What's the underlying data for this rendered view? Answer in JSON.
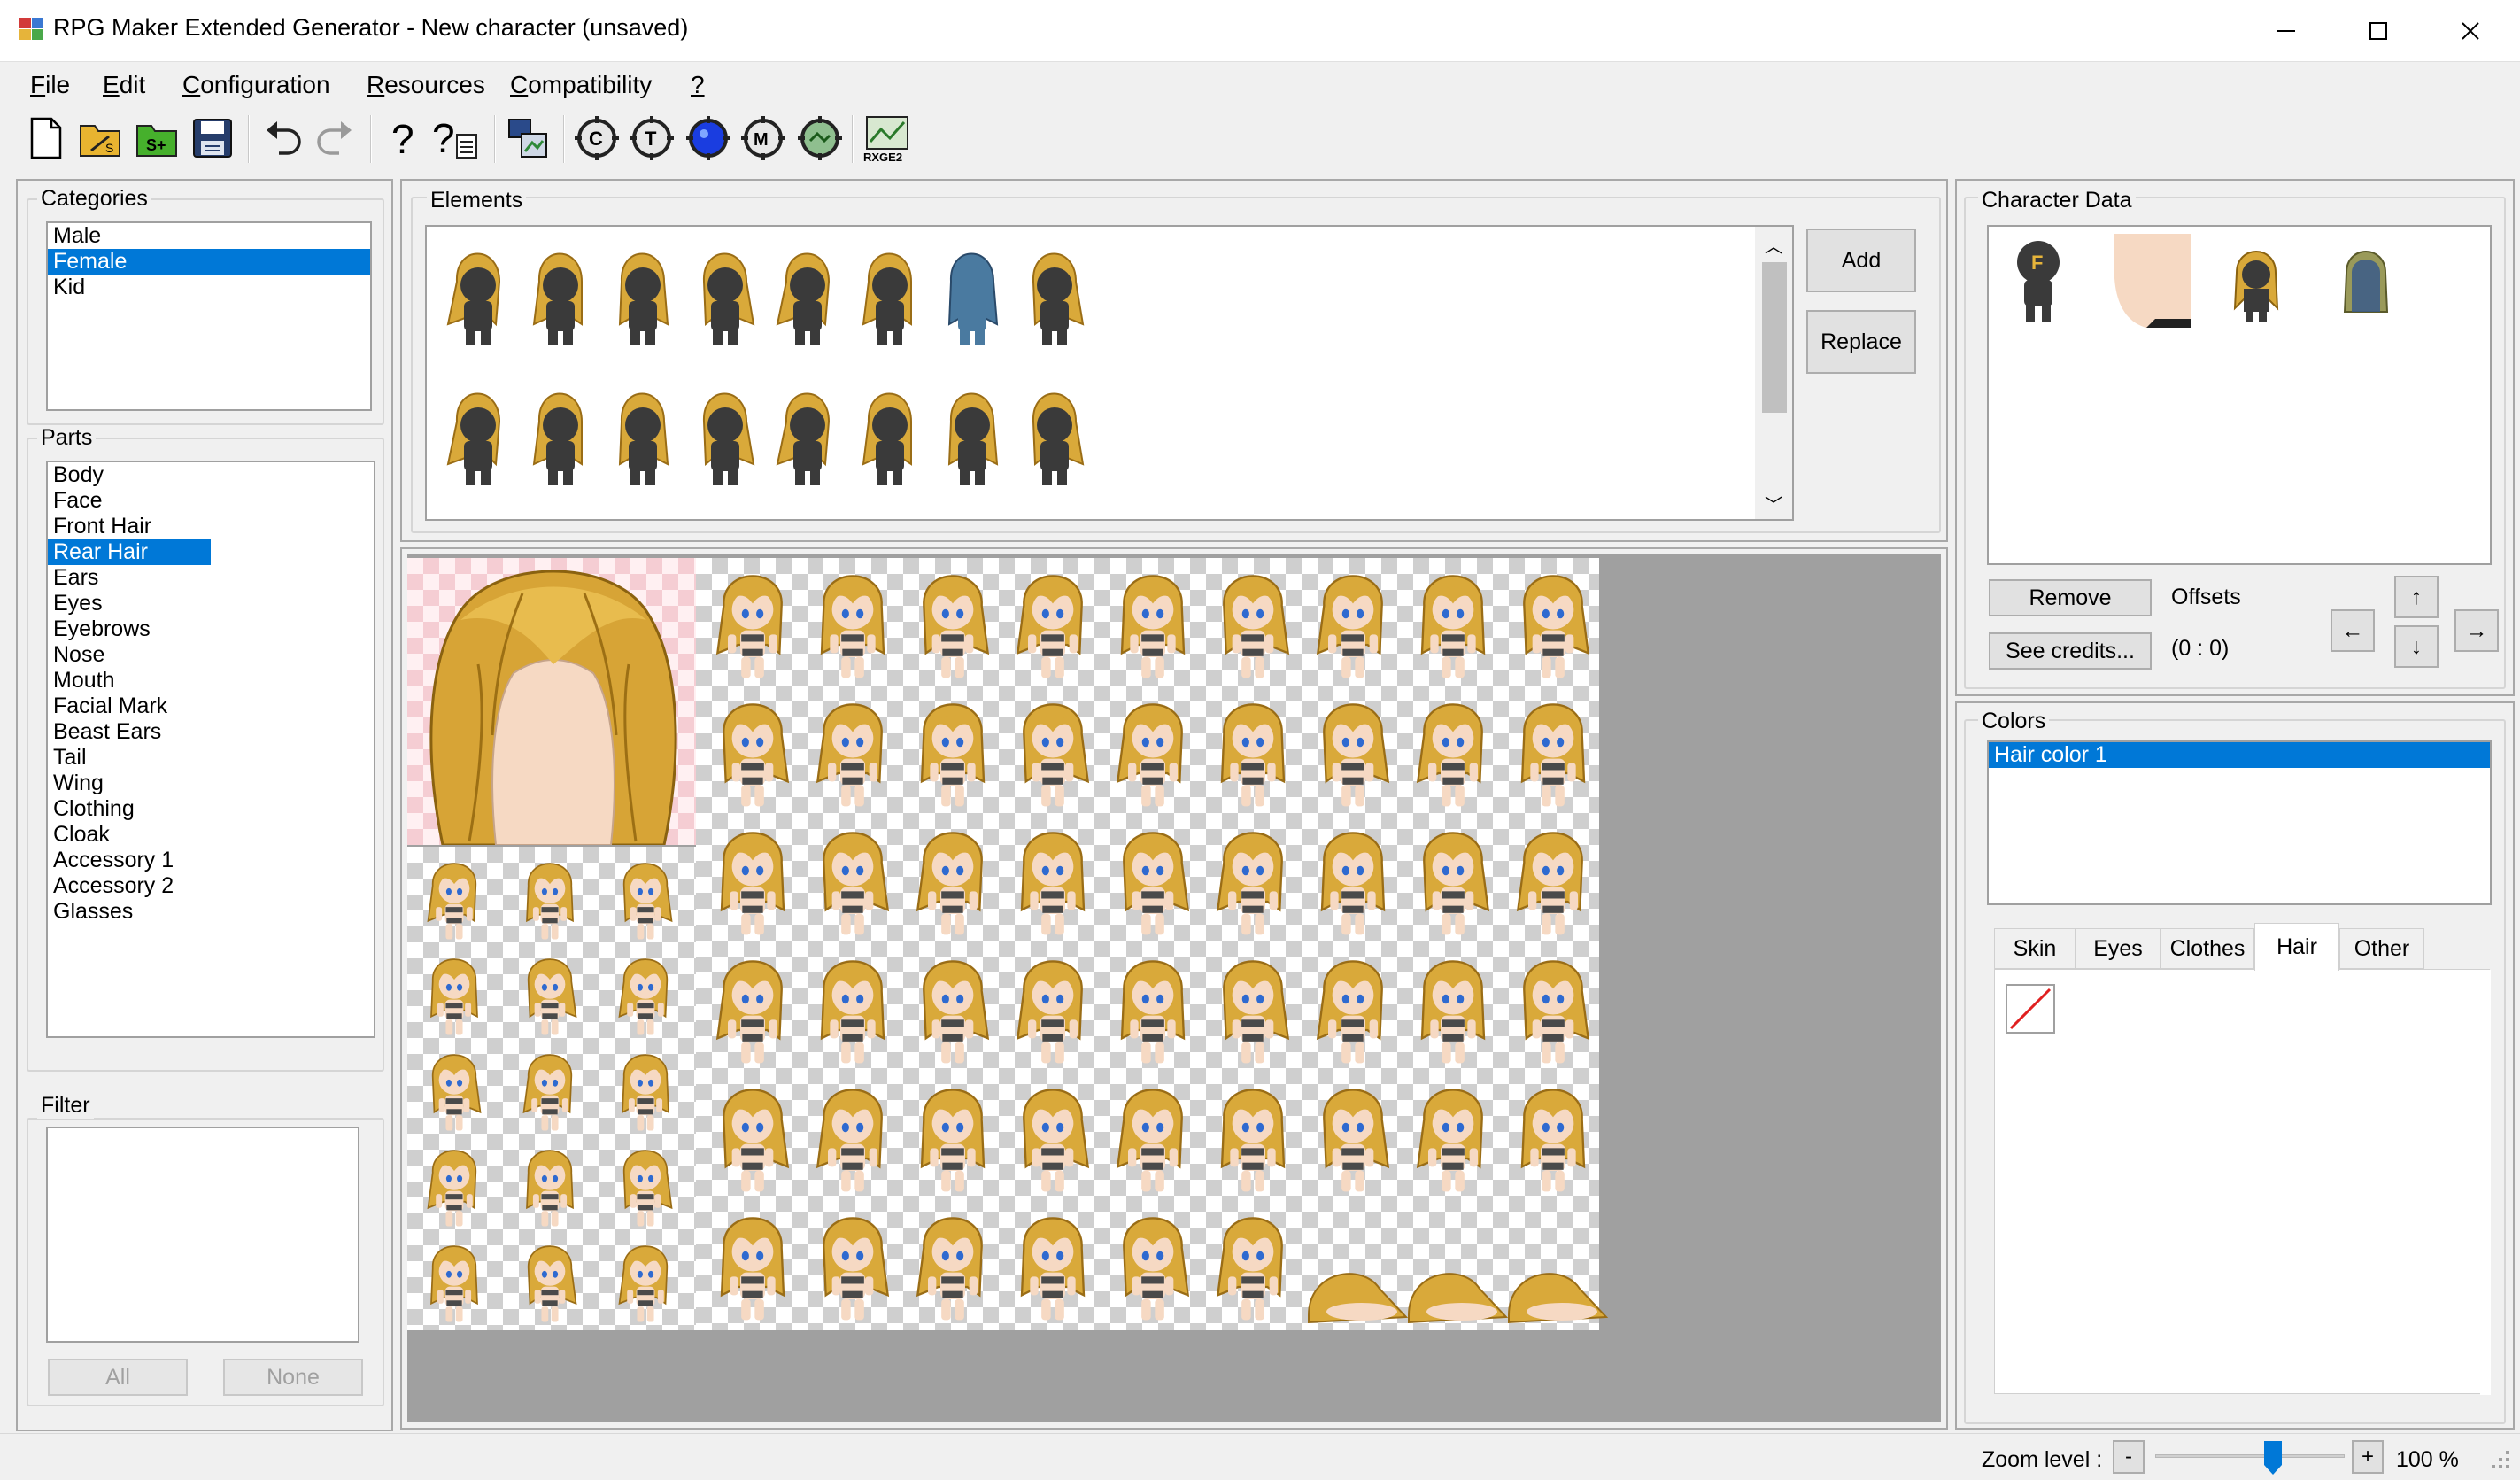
{
  "window": {
    "title": "RPG Maker Extended Generator - New character (unsaved)",
    "minimize_glyph": "—",
    "maximize_glyph": "☐",
    "close_glyph": "✕"
  },
  "menu": [
    {
      "label": "File",
      "accel": "F",
      "rest": "ile"
    },
    {
      "label": "Edit",
      "accel": "E",
      "rest": "dit"
    },
    {
      "label": "Configuration",
      "accel": "C",
      "rest": "onfiguration"
    },
    {
      "label": "Resources",
      "accel": "R",
      "rest": "esources"
    },
    {
      "label": "Compatibility",
      "accel": "C",
      "rest": "ompatibility"
    },
    {
      "label": "?",
      "accel": "?",
      "rest": ""
    }
  ],
  "toolbar": {
    "items": [
      "new-file-icon",
      "open-folder-icon",
      "add-folder-icon",
      "save-icon",
      "undo-icon",
      "redo-icon",
      "help-icon",
      "help-doc-icon",
      "export-icon",
      "target-c-icon",
      "target-t-icon",
      "target-blue-icon",
      "target-m-icon",
      "target-green-icon",
      "rxge2-icon"
    ],
    "rxge2_label": "RXGE2"
  },
  "categories": {
    "title": "Categories",
    "items": [
      "Male",
      "Female",
      "Kid"
    ],
    "selected": "Female"
  },
  "parts": {
    "title": "Parts",
    "items": [
      "Body",
      "Face",
      "Front Hair",
      "Rear Hair",
      "Ears",
      "Eyes",
      "Eyebrows",
      "Nose",
      "Mouth",
      "Facial Mark",
      "Beast Ears",
      "Tail",
      "Wing",
      "Clothing",
      "Cloak",
      "Accessory 1",
      "Accessory 2",
      "Glasses"
    ],
    "selected": "Rear Hair"
  },
  "filter": {
    "title": "Filter",
    "all_label": "All",
    "none_label": "None"
  },
  "elements": {
    "title": "Elements",
    "add_label": "Add",
    "replace_label": "Replace",
    "count": 16,
    "scroll_up": "︿",
    "scroll_down": "﹀"
  },
  "character_data": {
    "title": "Character Data",
    "badge_letter": "F",
    "remove_label": "Remove",
    "see_credits_label": "See credits...",
    "offsets_label": "Offsets",
    "offsets_value": "(0 : 0)",
    "arrow_up": "↑",
    "arrow_down": "↓",
    "arrow_left": "←",
    "arrow_right": "→"
  },
  "colors": {
    "title": "Colors",
    "items": [
      "Hair color 1"
    ],
    "selected": "Hair color 1",
    "tabs": [
      "Skin",
      "Eyes",
      "Clothes",
      "Hair",
      "Other"
    ],
    "active_tab": "Hair"
  },
  "statusbar": {
    "zoom_label": "Zoom level :",
    "zoom_minus": "-",
    "zoom_plus": "+",
    "zoom_value": "100 %",
    "zoom_percent": 100
  },
  "palette": {
    "accent": "#0078d7",
    "hair": "#d9a93a",
    "hair_dark": "#9a6d16",
    "silhouette": "#3a3a3a",
    "skin": "#f6d9c3"
  }
}
